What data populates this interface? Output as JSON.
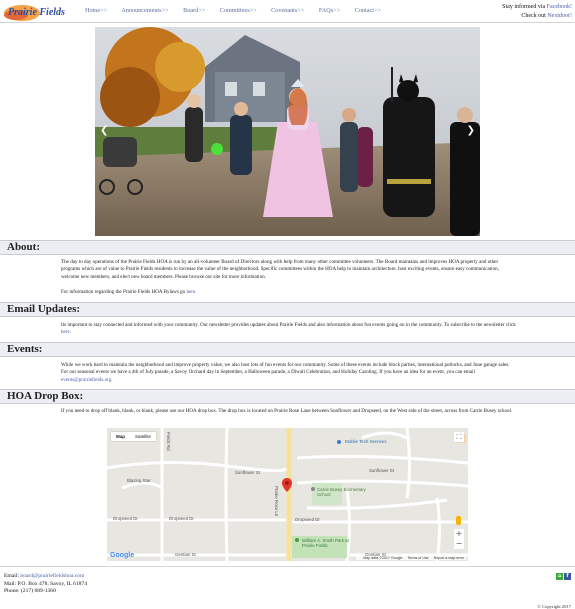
{
  "header": {
    "logo_text": "Prairie Fields",
    "nav": [
      "Home>>",
      "Announcements>>",
      "Board>>",
      "Committees>>",
      "Covenants>>",
      "FAQs>>",
      "Contact>>"
    ],
    "social_line1_prefix": "Stay informed via ",
    "social_line1_link": "Facebook!",
    "social_line2_prefix": "Check out ",
    "social_line2_link": "Nextdoor!"
  },
  "carousel": {
    "prev_icon": "chevron-left-icon",
    "next_icon": "chevron-right-icon"
  },
  "about": {
    "heading": "About:",
    "para1": "The day to day operations of the Prairie Fields HOA is run by an all-volunteer Board of Directors along with help from many other committee volunteers. The Board maintains and improves HOA property and other programs which are of value to Prairie Fields residents to increase the value of the neighborhood. Specific committees within the HOA help to maintain architecture, host exciting events, ensure easy communication, welcome new members, and elect new board members. Please browse our site for more information.",
    "para2_prefix": "For information regarding the Prairie Fields HOA Bylaws go ",
    "para2_link": "here",
    "para2_suffix": "."
  },
  "email": {
    "heading": "Email Updates:",
    "para_prefix": "Its important to stay connected and informed with your community. Our newsletter provides updates about Prairie Fields and also information about fun events going on in the community. To subscribe to the newsletter click ",
    "para_link": "here",
    "para_suffix": "."
  },
  "events": {
    "heading": "Events:",
    "para_prefix": "While we work hard to maintain the neighborhood and improve property value, we also host lots of fun events for our community. Some of these events include block parties, international potlucks, and June garage sales. For our seasonal events we have a 4th of July parade, a Savoy Orchard day in September, a Halloween parade, a Diwali Celebration, and Holiday Caroling. If you have an idea for an event, you can email ",
    "para_link": "events@prairiefields.org",
    "para_suffix": "."
  },
  "dropbox": {
    "heading": "HOA Drop Box:",
    "para": "If you need to drop off blank, blank, or blank, please use our HOA drop box. The drop box is located on Prairie Rose Lane between Sunflower and Dropseed, on the West side of the street, across from Carrie Busey school."
  },
  "map": {
    "tab_map": "Map",
    "tab_satellite": "Satellite",
    "labels": {
      "mobile_tech": "Mobile Tech Services",
      "sunflower1": "Sunflower St",
      "sunflower2": "Sunflower St",
      "blazing_star": "Blazing Star",
      "carrie_busey": "Carrie Busey Elementary School",
      "dropseed1": "Dropseed Dr",
      "dropseed2": "Dropseed Dr",
      "dropseed3": "Dropseed Dr",
      "william_smith": "William A. Smith Park at Prairie Fields",
      "gentian1": "Gentian St",
      "gentian2": "Gentian St",
      "prairie_rose": "Prairie Rose Ln",
      "fields": "Fields Rd"
    },
    "google": "Google",
    "footer": [
      "Map data ©2017 Google",
      "Terms of Use",
      "Report a map error"
    ],
    "zoom_in": "+",
    "zoom_out": "−"
  },
  "footer": {
    "email_label": "Email: ",
    "email_link": "board@prairiefieldshoa.com",
    "mail": "Mail: P.O. Box 478, Savoy, IL 61874",
    "phone": "Phone: (217) 689-1360",
    "copyright": "© Copyright 2017",
    "icon_nextdoor": "nextdoor-icon",
    "icon_facebook": "facebook-icon"
  },
  "colors": {
    "link": "#4a5ea8",
    "section_bg": "#eceef3",
    "nextdoor": "#3aa935",
    "facebook": "#3b5998"
  }
}
